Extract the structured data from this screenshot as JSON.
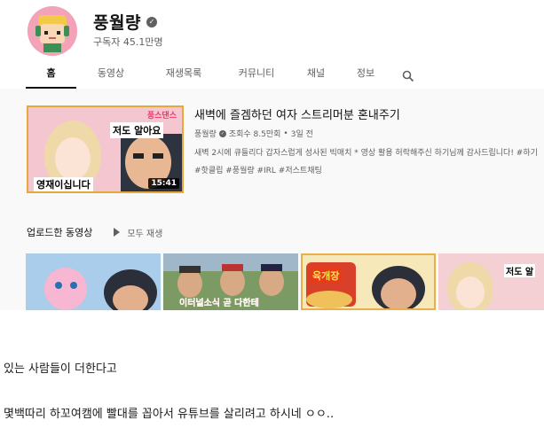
{
  "channel": {
    "name": "풍월량",
    "subscribers": "구독자 45.1만명",
    "avatar_icon": "character-avatar-icon",
    "verified_icon": "verified-check-icon"
  },
  "tabs": [
    {
      "label": "홈",
      "active": true
    },
    {
      "label": "동영상"
    },
    {
      "label": "재생목록"
    },
    {
      "label": "커뮤니티"
    },
    {
      "label": "채널"
    },
    {
      "label": "정보"
    }
  ],
  "search_icon": "search-icon",
  "featured": {
    "title": "새벽에 즐겜하던 여자 스트리머분 혼내주기",
    "channel": "풍월량",
    "views": "조회수 8.5만회",
    "dot": "•",
    "age": "3일 전",
    "description": "새벽 2시에 큐들리다 갑자스럽게 성사된 빅매치 * 영상 활용 허락해주신 하기님께 감사드립니다! #하기",
    "tags": "#핫클립 #풍월량 #IRL #저스트채팅",
    "duration": "15:41",
    "thumb_badge": "풍스댄스",
    "thumb_caption_top": "저도 알아요",
    "thumb_caption_bottom": "영재이십니다"
  },
  "shelf": {
    "title": "업로드한 동영상",
    "play_all": "모두 재생",
    "play_icon": "play-icon",
    "thumbs": [
      {
        "caption": ""
      },
      {
        "caption": "이터널소식 곧 다한테"
      },
      {
        "caption": "육개장"
      },
      {
        "caption": "저도 알"
      }
    ]
  },
  "post": {
    "line1": "있는 사람들이 더한다고",
    "line2": "몇백따리 하꼬여캠에  빨대를 꼽아서 유튜브를 살리려고 하시네 ㅇㅇ.."
  },
  "colors": {
    "content_bg": "#f9f9f9",
    "avatar_bg": "#f3a3b8",
    "accent_text": "#0f0f0f",
    "secondary_text": "#606060"
  }
}
